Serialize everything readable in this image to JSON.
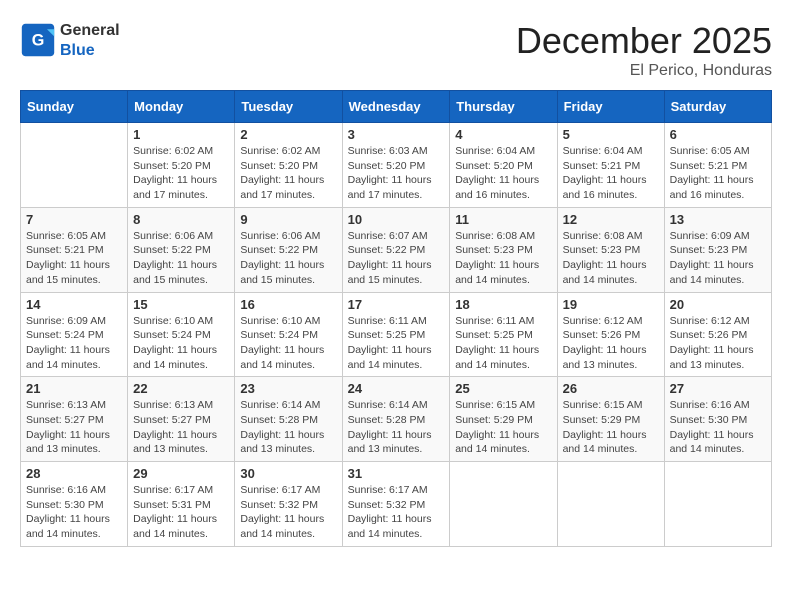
{
  "header": {
    "logo_general": "General",
    "logo_blue": "Blue",
    "month": "December 2025",
    "location": "El Perico, Honduras"
  },
  "weekdays": [
    "Sunday",
    "Monday",
    "Tuesday",
    "Wednesday",
    "Thursday",
    "Friday",
    "Saturday"
  ],
  "weeks": [
    [
      {
        "day": "",
        "info": ""
      },
      {
        "day": "1",
        "info": "Sunrise: 6:02 AM\nSunset: 5:20 PM\nDaylight: 11 hours\nand 17 minutes."
      },
      {
        "day": "2",
        "info": "Sunrise: 6:02 AM\nSunset: 5:20 PM\nDaylight: 11 hours\nand 17 minutes."
      },
      {
        "day": "3",
        "info": "Sunrise: 6:03 AM\nSunset: 5:20 PM\nDaylight: 11 hours\nand 17 minutes."
      },
      {
        "day": "4",
        "info": "Sunrise: 6:04 AM\nSunset: 5:20 PM\nDaylight: 11 hours\nand 16 minutes."
      },
      {
        "day": "5",
        "info": "Sunrise: 6:04 AM\nSunset: 5:21 PM\nDaylight: 11 hours\nand 16 minutes."
      },
      {
        "day": "6",
        "info": "Sunrise: 6:05 AM\nSunset: 5:21 PM\nDaylight: 11 hours\nand 16 minutes."
      }
    ],
    [
      {
        "day": "7",
        "info": "Sunrise: 6:05 AM\nSunset: 5:21 PM\nDaylight: 11 hours\nand 15 minutes."
      },
      {
        "day": "8",
        "info": "Sunrise: 6:06 AM\nSunset: 5:22 PM\nDaylight: 11 hours\nand 15 minutes."
      },
      {
        "day": "9",
        "info": "Sunrise: 6:06 AM\nSunset: 5:22 PM\nDaylight: 11 hours\nand 15 minutes."
      },
      {
        "day": "10",
        "info": "Sunrise: 6:07 AM\nSunset: 5:22 PM\nDaylight: 11 hours\nand 15 minutes."
      },
      {
        "day": "11",
        "info": "Sunrise: 6:08 AM\nSunset: 5:23 PM\nDaylight: 11 hours\nand 14 minutes."
      },
      {
        "day": "12",
        "info": "Sunrise: 6:08 AM\nSunset: 5:23 PM\nDaylight: 11 hours\nand 14 minutes."
      },
      {
        "day": "13",
        "info": "Sunrise: 6:09 AM\nSunset: 5:23 PM\nDaylight: 11 hours\nand 14 minutes."
      }
    ],
    [
      {
        "day": "14",
        "info": "Sunrise: 6:09 AM\nSunset: 5:24 PM\nDaylight: 11 hours\nand 14 minutes."
      },
      {
        "day": "15",
        "info": "Sunrise: 6:10 AM\nSunset: 5:24 PM\nDaylight: 11 hours\nand 14 minutes."
      },
      {
        "day": "16",
        "info": "Sunrise: 6:10 AM\nSunset: 5:24 PM\nDaylight: 11 hours\nand 14 minutes."
      },
      {
        "day": "17",
        "info": "Sunrise: 6:11 AM\nSunset: 5:25 PM\nDaylight: 11 hours\nand 14 minutes."
      },
      {
        "day": "18",
        "info": "Sunrise: 6:11 AM\nSunset: 5:25 PM\nDaylight: 11 hours\nand 14 minutes."
      },
      {
        "day": "19",
        "info": "Sunrise: 6:12 AM\nSunset: 5:26 PM\nDaylight: 11 hours\nand 13 minutes."
      },
      {
        "day": "20",
        "info": "Sunrise: 6:12 AM\nSunset: 5:26 PM\nDaylight: 11 hours\nand 13 minutes."
      }
    ],
    [
      {
        "day": "21",
        "info": "Sunrise: 6:13 AM\nSunset: 5:27 PM\nDaylight: 11 hours\nand 13 minutes."
      },
      {
        "day": "22",
        "info": "Sunrise: 6:13 AM\nSunset: 5:27 PM\nDaylight: 11 hours\nand 13 minutes."
      },
      {
        "day": "23",
        "info": "Sunrise: 6:14 AM\nSunset: 5:28 PM\nDaylight: 11 hours\nand 13 minutes."
      },
      {
        "day": "24",
        "info": "Sunrise: 6:14 AM\nSunset: 5:28 PM\nDaylight: 11 hours\nand 13 minutes."
      },
      {
        "day": "25",
        "info": "Sunrise: 6:15 AM\nSunset: 5:29 PM\nDaylight: 11 hours\nand 14 minutes."
      },
      {
        "day": "26",
        "info": "Sunrise: 6:15 AM\nSunset: 5:29 PM\nDaylight: 11 hours\nand 14 minutes."
      },
      {
        "day": "27",
        "info": "Sunrise: 6:16 AM\nSunset: 5:30 PM\nDaylight: 11 hours\nand 14 minutes."
      }
    ],
    [
      {
        "day": "28",
        "info": "Sunrise: 6:16 AM\nSunset: 5:30 PM\nDaylight: 11 hours\nand 14 minutes."
      },
      {
        "day": "29",
        "info": "Sunrise: 6:17 AM\nSunset: 5:31 PM\nDaylight: 11 hours\nand 14 minutes."
      },
      {
        "day": "30",
        "info": "Sunrise: 6:17 AM\nSunset: 5:32 PM\nDaylight: 11 hours\nand 14 minutes."
      },
      {
        "day": "31",
        "info": "Sunrise: 6:17 AM\nSunset: 5:32 PM\nDaylight: 11 hours\nand 14 minutes."
      },
      {
        "day": "",
        "info": ""
      },
      {
        "day": "",
        "info": ""
      },
      {
        "day": "",
        "info": ""
      }
    ]
  ]
}
